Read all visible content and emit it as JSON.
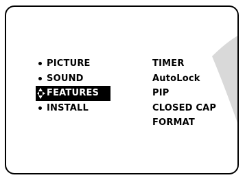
{
  "main_menu": {
    "items": [
      {
        "label": "PICTURE",
        "selected": false
      },
      {
        "label": "SOUND",
        "selected": false
      },
      {
        "label": "FEATURES",
        "selected": true
      },
      {
        "label": "INSTALL",
        "selected": false
      }
    ]
  },
  "sub_menu": {
    "items": [
      {
        "label": "TIMER"
      },
      {
        "label": "AutoLock"
      },
      {
        "label": "PIP"
      },
      {
        "label": "CLOSED CAP"
      },
      {
        "label": "FORMAT"
      }
    ]
  },
  "colors": {
    "text": "#000000",
    "background": "#ffffff",
    "highlight_bg": "#000000",
    "highlight_text": "#ffffff",
    "decor_gray": "#d9d9d9"
  },
  "icons": {
    "bullet": "bullet-dot-icon",
    "selection": "four-way-arrow-icon"
  }
}
